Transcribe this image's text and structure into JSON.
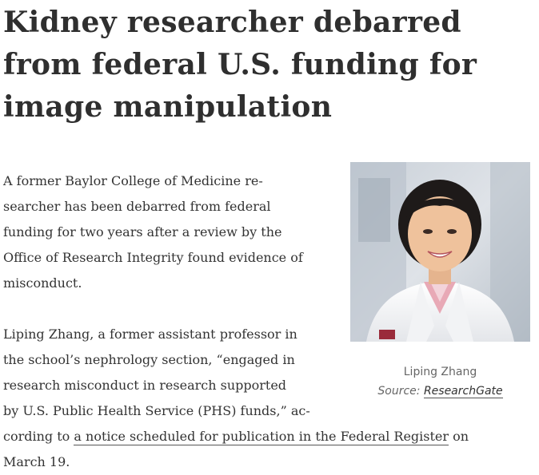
{
  "article": {
    "title": "Kidney researcher debarred from federal U.S. funding for image manipulation",
    "paragraph1": {
      "lines": [
        "A former Baylor College of Medicine re-",
        "searcher has been debarred from federal",
        "funding for two years after a review by the",
        "Office of Research Integrity found evidence of",
        "misconduct."
      ]
    },
    "paragraph2": {
      "lines": [
        "Liping Zhang, a former assistant professor in",
        "the school’s nephrology section, “engaged in",
        "research misconduct in research supported",
        "by U.S. Public Health Service (PHS) funds,” ac-"
      ],
      "line5_prefix": "cording to ",
      "link_text": "a notice scheduled for publication in the Federal Register",
      "line5_suffix": " on",
      "line6": "March 19."
    }
  },
  "figure": {
    "caption_name": "Liping Zhang",
    "source_label": "Source: ",
    "source_link": "ResearchGate"
  }
}
